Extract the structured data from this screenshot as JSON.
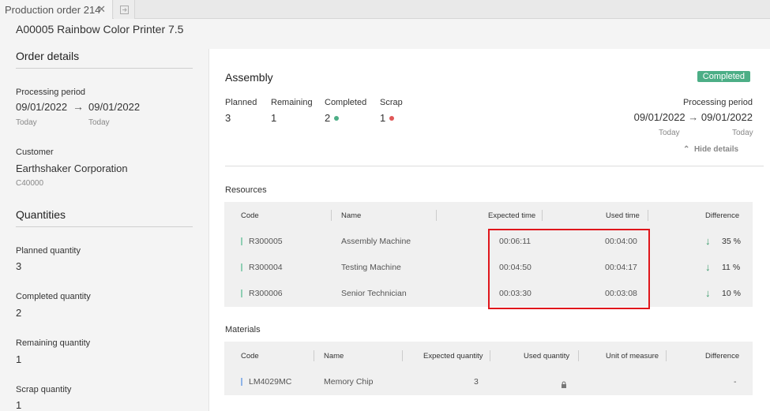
{
  "tab": {
    "label": "Production order 214"
  },
  "page": {
    "title": "A00005 Rainbow Color Printer 7.5"
  },
  "order_details": {
    "title": "Order details",
    "processing_period_label": "Processing period",
    "start": "09/01/2022",
    "end": "09/01/2022",
    "start_sub": "Today",
    "end_sub": "Today",
    "customer_label": "Customer",
    "customer_name": "Earthshaker Corporation",
    "customer_code": "C40000"
  },
  "quantities": {
    "title": "Quantities",
    "items": [
      {
        "label": "Planned quantity",
        "value": "3"
      },
      {
        "label": "Completed quantity",
        "value": "2"
      },
      {
        "label": "Remaining quantity",
        "value": "1"
      },
      {
        "label": "Scrap quantity",
        "value": "1"
      }
    ]
  },
  "assembly": {
    "title": "Assembly",
    "status": "Completed",
    "planned_label": "Planned",
    "planned": "3",
    "remaining_label": "Remaining",
    "remaining": "1",
    "completed_label": "Completed",
    "completed": "2",
    "scrap_label": "Scrap",
    "scrap": "1",
    "pp_label": "Processing period",
    "pp_start": "09/01/2022",
    "pp_end": "09/01/2022",
    "pp_start_sub": "Today",
    "pp_end_sub": "Today",
    "hide_details": "Hide details"
  },
  "resources": {
    "title": "Resources",
    "headers": [
      "Code",
      "Name",
      "Expected time",
      "Used time",
      "Difference"
    ],
    "rows": [
      {
        "code": "R300005",
        "name": "Assembly Machine",
        "expected": "00:06:11",
        "used": "00:04:00",
        "diff": "35 %"
      },
      {
        "code": "R300004",
        "name": "Testing Machine",
        "expected": "00:04:50",
        "used": "00:04:17",
        "diff": "11 %"
      },
      {
        "code": "R300006",
        "name": "Senior Technician",
        "expected": "00:03:30",
        "used": "00:03:08",
        "diff": "10 %"
      }
    ]
  },
  "materials": {
    "title": "Materials",
    "headers": [
      "Code",
      "Name",
      "Expected quantity",
      "Used quantity",
      "Unit of measure",
      "Difference"
    ],
    "rows": [
      {
        "code": "LM4029MC",
        "name": "Memory Chip",
        "expected": "3",
        "used": "",
        "uom": "",
        "diff": "-"
      }
    ]
  },
  "colors": {
    "completed_badge": "#4cae86",
    "completed_dot": "#4cae86",
    "scrap_dot": "#e05757",
    "resource_mark": "#8fcfb4",
    "material_mark": "#8fb4e8",
    "highlight": "#e0161b"
  },
  "icons": {
    "close": "close-icon",
    "new_tab": "new-tab-icon",
    "arrow": "arrow-right-icon",
    "chevron": "chevron-up-icon",
    "down_arrow": "arrow-down-icon",
    "lock": "lock-icon"
  }
}
